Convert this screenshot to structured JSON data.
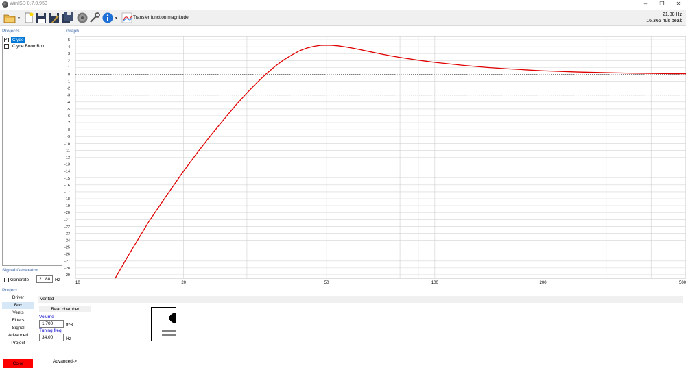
{
  "window": {
    "title": "WinISD 0.7.0.950",
    "controls": {
      "minimize": "–",
      "restore": "❐",
      "close": "✕"
    }
  },
  "toolbar": {
    "mode_label": "Transfer function magnitude",
    "icons": [
      "open-folder-icon",
      "new-document-icon",
      "save-icon",
      "save-as-icon",
      "save-all-icon",
      "speaker-icon",
      "wrench-icon",
      "info-icon",
      "chart-icon"
    ],
    "readout_freq": "21.88 Hz",
    "readout_value": "16.366 m/s peak"
  },
  "projects": {
    "label": "Projects",
    "items": [
      {
        "name": "Clyde",
        "checked": true,
        "selected": true,
        "check_mark": "✓"
      },
      {
        "name": "Clyde BoomBox",
        "checked": false,
        "selected": false,
        "check_mark": ""
      }
    ]
  },
  "signal_generator": {
    "label": "Signal Generator",
    "generate_label": "Generate",
    "frequency": "21.88",
    "unit": "Hz"
  },
  "project_nav": {
    "label": "Project",
    "items": [
      "Driver",
      "Box",
      "Vents",
      "Filters",
      "Signal",
      "Advanced",
      "Project"
    ],
    "active": "Box",
    "color_button": "Color"
  },
  "box": {
    "type": "vented",
    "chamber_header": "Rear chamber",
    "volume_label": "Volume",
    "volume_value": "1.700",
    "volume_unit": "ft^3",
    "tuning_label": "Tuning freq.",
    "tuning_value": "34.00",
    "tuning_unit": "Hz",
    "advanced_link": "Advanced->"
  },
  "graph": {
    "label": "Graph"
  },
  "chart_data": {
    "type": "line",
    "x_scale": "log",
    "xlim": [
      10,
      500
    ],
    "ylim": [
      -29.5,
      5.5
    ],
    "x_ticks": [
      10,
      20,
      50,
      100,
      200,
      500
    ],
    "y_ticks": [
      5,
      4,
      3,
      2,
      1,
      0,
      -1,
      -2,
      -3,
      -4,
      -5,
      -6,
      -7,
      -8,
      -9,
      -10,
      -11,
      -12,
      -13,
      -14,
      -15,
      -16,
      -17,
      -18,
      -19,
      -20,
      -21,
      -22,
      -23,
      -24,
      -25,
      -26,
      -27,
      -28,
      -29
    ],
    "grid": true,
    "reference_lines": [
      0,
      -3
    ],
    "line_color": "#e00000",
    "series": [
      {
        "x": [
          12.9,
          14,
          16,
          18,
          20,
          22,
          24,
          26,
          28,
          30,
          32,
          34,
          36,
          38,
          40,
          42,
          44,
          46,
          48,
          50,
          52,
          54,
          56,
          58,
          60,
          65,
          70,
          75,
          80,
          90,
          100,
          120,
          140,
          160,
          180,
          200,
          250,
          300,
          350,
          400,
          450,
          500
        ],
        "y": [
          -29.5,
          -26.3,
          -21.3,
          -17.4,
          -14.0,
          -11.1,
          -8.6,
          -6.4,
          -4.4,
          -2.7,
          -1.2,
          0.1,
          1.2,
          2.1,
          2.8,
          3.4,
          3.8,
          4.05,
          4.2,
          4.23,
          4.2,
          4.12,
          4.0,
          3.87,
          3.73,
          3.35,
          3.0,
          2.7,
          2.45,
          2.05,
          1.73,
          1.3,
          1.0,
          0.8,
          0.65,
          0.52,
          0.34,
          0.24,
          0.17,
          0.13,
          0.1,
          0.08
        ]
      }
    ]
  },
  "colors": {
    "accent": "#0078d7",
    "curve": "#e00000",
    "section_label": "#6f8fbf",
    "color_swatch": "#ff0000"
  }
}
